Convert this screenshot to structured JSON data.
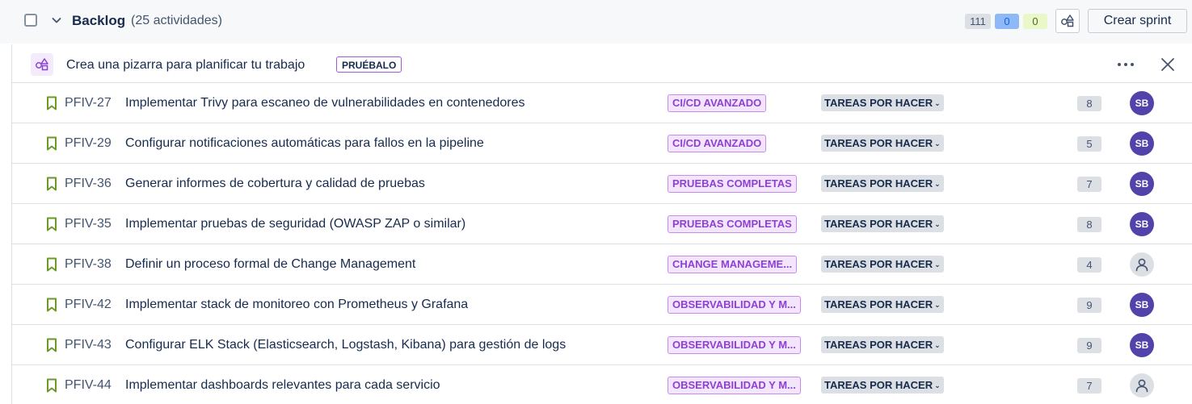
{
  "backlog": {
    "title": "Backlog",
    "count_label": "(25 actividades)",
    "badges": {
      "todo": "111",
      "in_progress": "0",
      "done": "0"
    },
    "create_sprint_label": "Crear sprint"
  },
  "banner": {
    "text": "Crea una pizarra para planificar tu trabajo",
    "try_label": "PRUÉBALO"
  },
  "colors": {
    "accent_purple": "#8f40d4",
    "avatar_bg": "#5243aa",
    "story_green": "#6a9a23"
  },
  "issues": [
    {
      "key": "PFIV-27",
      "summary": "Implementar Trivy para escaneo de vulnerabilidades en contenedores",
      "epic": "CI/CD AVANZADO",
      "status": "TAREAS POR HACER",
      "points": "8",
      "assignee": "SB"
    },
    {
      "key": "PFIV-29",
      "summary": "Configurar notificaciones automáticas para fallos en la pipeline",
      "epic": "CI/CD AVANZADO",
      "status": "TAREAS POR HACER",
      "points": "5",
      "assignee": "SB"
    },
    {
      "key": "PFIV-36",
      "summary": "Generar informes de cobertura y calidad de pruebas",
      "epic": "PRUEBAS COMPLETAS",
      "status": "TAREAS POR HACER",
      "points": "7",
      "assignee": "SB"
    },
    {
      "key": "PFIV-35",
      "summary": "Implementar pruebas de seguridad (OWASP ZAP o similar)",
      "epic": "PRUEBAS COMPLETAS",
      "status": "TAREAS POR HACER",
      "points": "8",
      "assignee": "SB"
    },
    {
      "key": "PFIV-38",
      "summary": "Definir un proceso formal de Change Management",
      "epic": "CHANGE MANAGEME...",
      "status": "TAREAS POR HACER",
      "points": "4",
      "assignee": ""
    },
    {
      "key": "PFIV-42",
      "summary": "Implementar stack de monitoreo con Prometheus y Grafana",
      "epic": "OBSERVABILIDAD Y M...",
      "status": "TAREAS POR HACER",
      "points": "9",
      "assignee": "SB"
    },
    {
      "key": "PFIV-43",
      "summary": "Configurar ELK Stack (Elasticsearch, Logstash, Kibana) para gestión de logs",
      "epic": "OBSERVABILIDAD Y M...",
      "status": "TAREAS POR HACER",
      "points": "9",
      "assignee": "SB"
    },
    {
      "key": "PFIV-44",
      "summary": "Implementar dashboards relevantes para cada servicio",
      "epic": "OBSERVABILIDAD Y M...",
      "status": "TAREAS POR HACER",
      "points": "7",
      "assignee": ""
    }
  ]
}
